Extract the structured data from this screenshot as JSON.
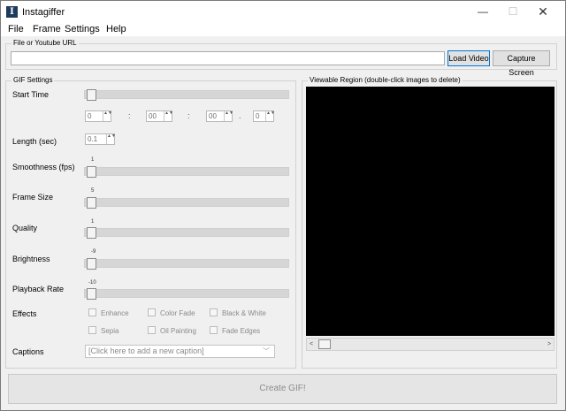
{
  "window": {
    "title": "Instagiffer",
    "icon_letter": "I",
    "controls": {
      "minimize": "—",
      "maximize": "☐",
      "close": "✕"
    }
  },
  "menu": {
    "items": [
      "File",
      "Frame",
      "Settings",
      "Help"
    ]
  },
  "url_section": {
    "legend": "File or Youtube URL",
    "url_value": "",
    "load_label": "Load Video",
    "capture_label": "Capture Screen"
  },
  "gif_settings": {
    "legend": "GIF Settings",
    "start_time_label": "Start Time",
    "start_time_fields": [
      "0",
      "00",
      "00",
      "0"
    ],
    "separators": [
      ":",
      ":",
      "."
    ],
    "length_label": "Length (sec)",
    "length_value": "0.1",
    "smoothness_label": "Smoothness (fps)",
    "smoothness_value": "1",
    "frame_size_label": "Frame Size",
    "frame_size_value": "5",
    "quality_label": "Quality",
    "quality_value": "1",
    "brightness_label": "Brightness",
    "brightness_value": "-9",
    "playback_label": "Playback Rate",
    "playback_value": "-10",
    "effects_label": "Effects",
    "effects": [
      "Enhance",
      "Color Fade",
      "Black & White",
      "Sepia",
      "Oil Painting",
      "Fade Edges"
    ],
    "captions_label": "Captions",
    "captions_placeholder": "[Click here to add a new caption]"
  },
  "viewer": {
    "legend": "Viewable Region (double-click images to delete)",
    "scroll_left": "<",
    "scroll_right": ">"
  },
  "create_label": "Create GIF!",
  "icons": {
    "spin": "▲▼",
    "combo_arrow": "﹀"
  }
}
